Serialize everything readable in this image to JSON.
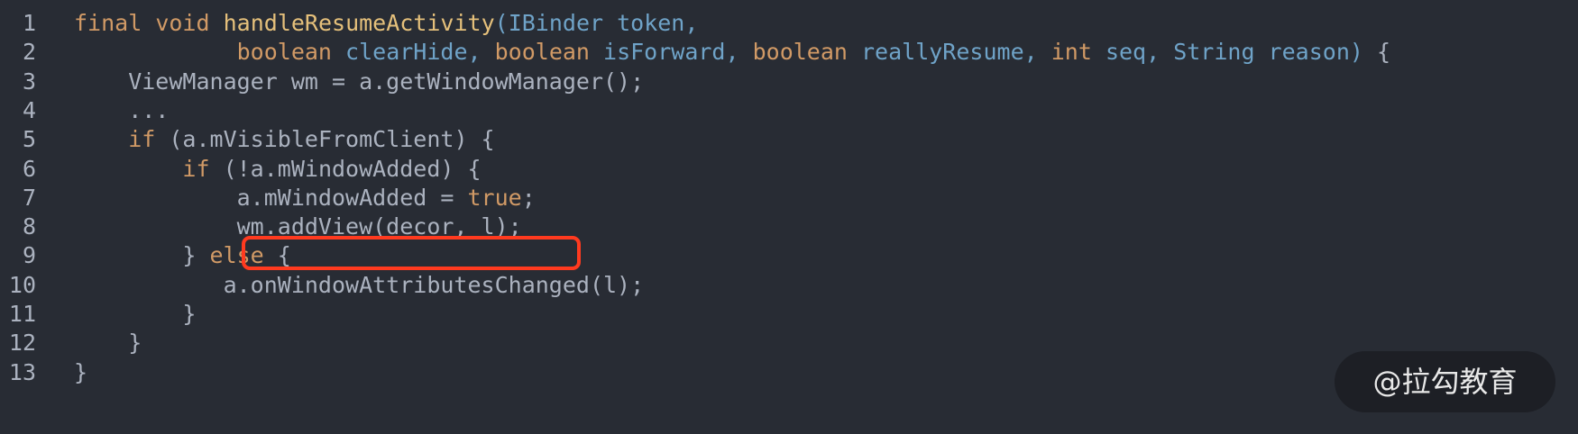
{
  "colors": {
    "background": "#282c34",
    "keyword": "#d19a66",
    "function": "#e5c07b",
    "identifier": "#6fa3c8",
    "plain": "#abb2bf",
    "highlight_border": "#ff3a1f"
  },
  "lines": [
    {
      "number": "1",
      "tokens": [
        {
          "t": "final",
          "c": "kw"
        },
        {
          "t": " ",
          "c": "pl"
        },
        {
          "t": "void",
          "c": "kw"
        },
        {
          "t": " ",
          "c": "pl"
        },
        {
          "t": "handleResumeActivity",
          "c": "fn"
        },
        {
          "t": "(IBinder token,",
          "c": "ty"
        }
      ]
    },
    {
      "number": "2",
      "tokens": [
        {
          "t": "            ",
          "c": "pl"
        },
        {
          "t": "boolean",
          "c": "kw"
        },
        {
          "t": " clearHide, ",
          "c": "ty"
        },
        {
          "t": "boolean",
          "c": "kw"
        },
        {
          "t": " isForward, ",
          "c": "ty"
        },
        {
          "t": "boolean",
          "c": "kw"
        },
        {
          "t": " reallyResume, ",
          "c": "ty"
        },
        {
          "t": "int",
          "c": "kw"
        },
        {
          "t": " seq, String reason)",
          "c": "ty"
        },
        {
          "t": " {",
          "c": "pl"
        }
      ]
    },
    {
      "number": "3",
      "tokens": [
        {
          "t": "    ViewManager wm = a.getWindowManager();",
          "c": "pl"
        }
      ]
    },
    {
      "number": "4",
      "tokens": [
        {
          "t": "    ...",
          "c": "pl"
        }
      ]
    },
    {
      "number": "5",
      "tokens": [
        {
          "t": "    ",
          "c": "pl"
        },
        {
          "t": "if",
          "c": "kw"
        },
        {
          "t": " (a.mVisibleFromClient) {",
          "c": "pl"
        }
      ]
    },
    {
      "number": "6",
      "tokens": [
        {
          "t": "        ",
          "c": "pl"
        },
        {
          "t": "if",
          "c": "kw"
        },
        {
          "t": " (!a.mWindowAdded) {",
          "c": "pl"
        }
      ]
    },
    {
      "number": "7",
      "tokens": [
        {
          "t": "            a.mWindowAdded = ",
          "c": "pl"
        },
        {
          "t": "true",
          "c": "kw"
        },
        {
          "t": ";",
          "c": "pl"
        }
      ]
    },
    {
      "number": "8",
      "tokens": [
        {
          "t": "            wm.addView(decor, l);",
          "c": "pl"
        }
      ]
    },
    {
      "number": "9",
      "tokens": [
        {
          "t": "        } ",
          "c": "pl"
        },
        {
          "t": "else",
          "c": "kw"
        },
        {
          "t": " {",
          "c": "pl"
        }
      ]
    },
    {
      "number": "10",
      "tokens": [
        {
          "t": "           a.onWindowAttributesChanged(l);",
          "c": "pl"
        }
      ]
    },
    {
      "number": "11",
      "tokens": [
        {
          "t": "        }",
          "c": "pl"
        }
      ]
    },
    {
      "number": "12",
      "tokens": [
        {
          "t": "    }",
          "c": "pl"
        }
      ]
    },
    {
      "number": "13",
      "tokens": [
        {
          "t": "}",
          "c": "pl"
        }
      ]
    }
  ],
  "highlight": {
    "line": "8",
    "text": "wm.addView(decor, l);"
  },
  "watermark": {
    "text": "@拉勾教育"
  }
}
